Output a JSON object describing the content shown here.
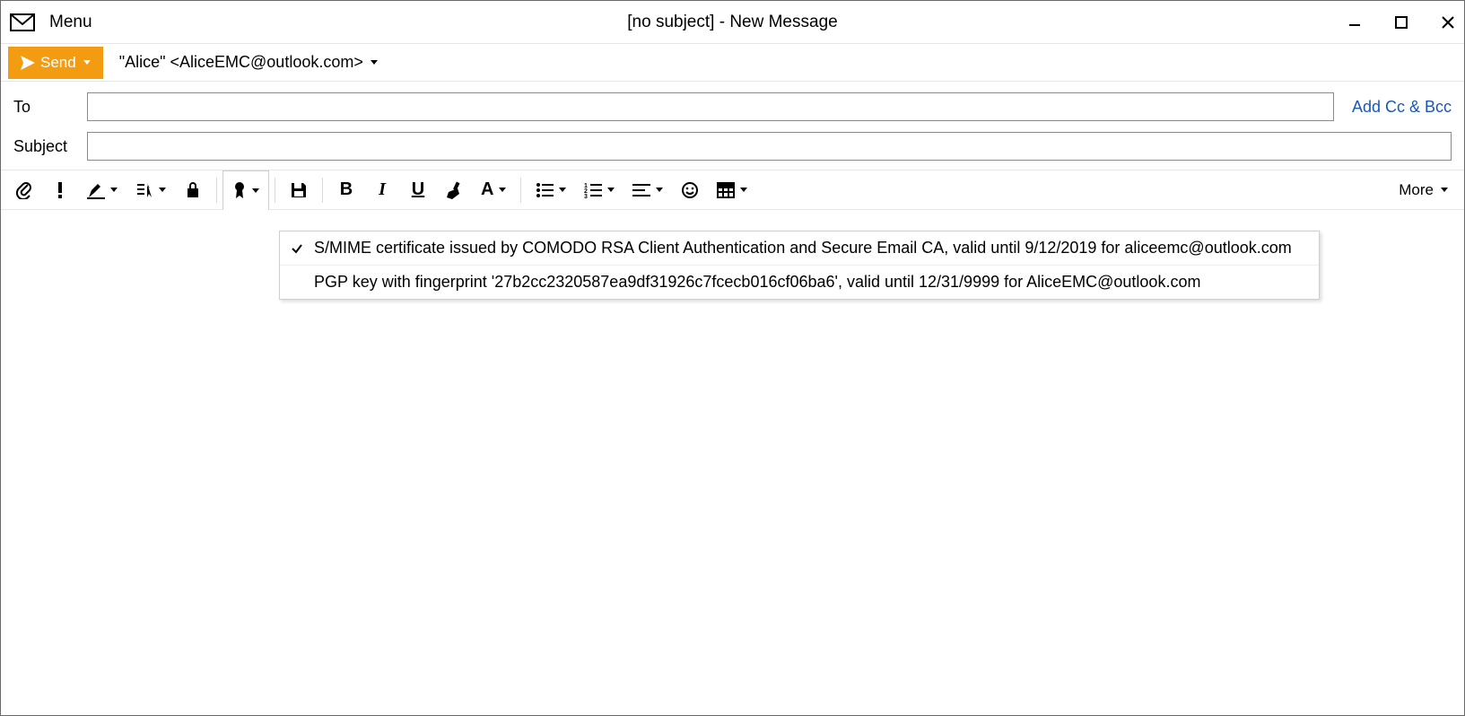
{
  "titlebar": {
    "menu_label": "Menu",
    "window_title": "[no subject] - New Message"
  },
  "send": {
    "label": "Send"
  },
  "from": {
    "display": "\"Alice\" <AliceEMC@outlook.com>"
  },
  "fields": {
    "to_label": "To",
    "to_value": "",
    "subject_label": "Subject",
    "subject_value": "",
    "add_cc_label": "Add Cc & Bcc"
  },
  "toolbar": {
    "more_label": "More"
  },
  "cert_menu": {
    "items": [
      {
        "checked": true,
        "label": "S/MIME certificate issued by COMODO RSA Client Authentication and Secure Email CA, valid until 9/12/2019 for aliceemc@outlook.com"
      },
      {
        "checked": false,
        "label": "PGP key with fingerprint '27b2cc2320587ea9df31926c7fcecb016cf06ba6', valid until 12/31/9999 for AliceEMC@outlook.com"
      }
    ]
  }
}
